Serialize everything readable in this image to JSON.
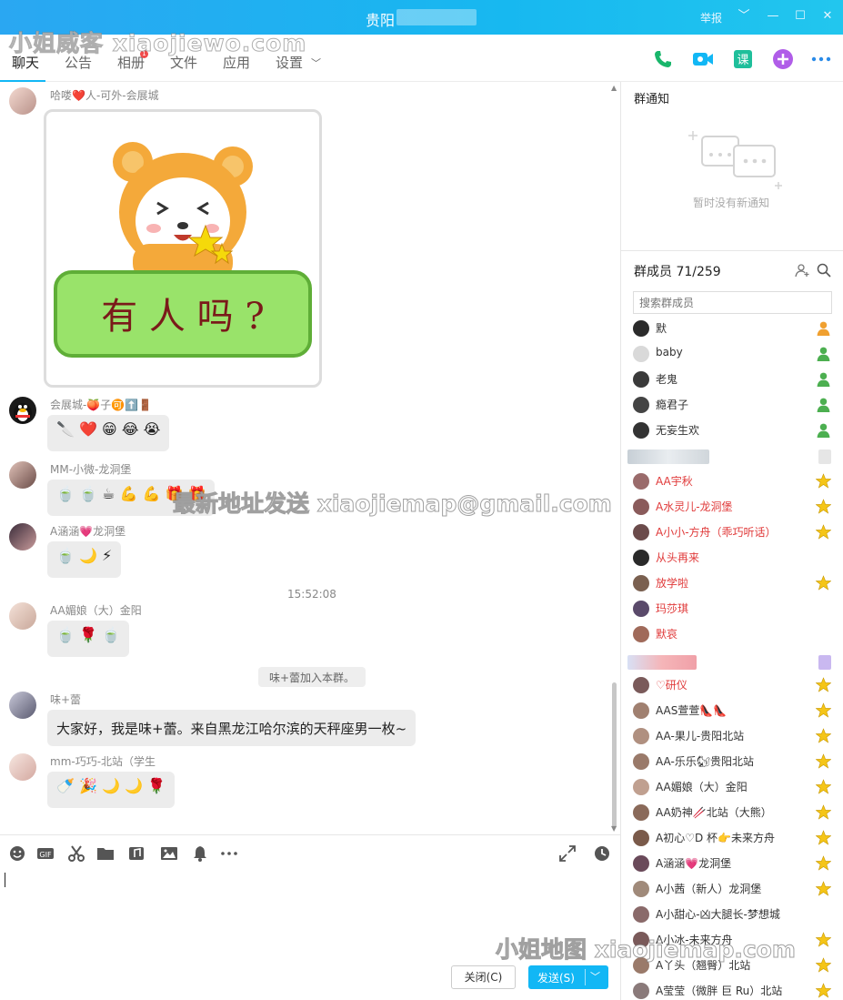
{
  "window": {
    "title": "贵阳",
    "report": "举报",
    "controls": [
      "chevron-down",
      "minimize",
      "maximize",
      "close"
    ]
  },
  "watermarks": {
    "top": "小姐威客 xiaojiewo.com",
    "middle": "最新地址发送 xiaojiemap@gmail.com",
    "bottom": "小姐地图 xiaojiemap.com"
  },
  "tabs": [
    {
      "label": "聊天",
      "active": true
    },
    {
      "label": "公告"
    },
    {
      "label": "相册",
      "badge": "1"
    },
    {
      "label": "文件"
    },
    {
      "label": "应用"
    },
    {
      "label": "设置"
    }
  ],
  "toolbar_icons": [
    "phone-icon",
    "video-icon",
    "course-icon",
    "add-app-icon",
    "more-icon"
  ],
  "messages": [
    {
      "sender": "哈喽❤️人-可外-会展城",
      "type": "sticker",
      "sticker_text": "有 人 吗 ?"
    },
    {
      "sender": "会展城-🍑子🉑⬆️🚪",
      "emojis": [
        "🔪",
        "❤️",
        "😁",
        "😂",
        "😭"
      ]
    },
    {
      "sender": "MM-小微-龙洞堡",
      "emojis": [
        "🍵",
        "🍵",
        "☕",
        "💪",
        "💪",
        "🎁",
        "🎁"
      ]
    },
    {
      "sender": "A涵涵💗龙洞堡",
      "emojis": [
        "🍵",
        "🌙",
        "⚡"
      ]
    },
    {
      "sender": "AA媚娘（大）金阳",
      "emojis": [
        "🍵",
        "🌹",
        "🍵"
      ]
    },
    {
      "sender": "味+蕾",
      "text": "大家好，我是味+蕾。来自黑龙江哈尔滨的天秤座男一枚~"
    },
    {
      "sender": "mm-巧巧-北站（学生",
      "emojis": [
        "🍼",
        "🎉",
        "🌙",
        "🌙",
        "🌹"
      ]
    }
  ],
  "timestamp": "15:52:08",
  "system_message": "味+蕾加入本群。",
  "input_toolbar": [
    "emoji-icon",
    "gif-icon",
    "scissors-icon",
    "folder-icon",
    "music-icon",
    "image-icon",
    "bell-icon",
    "more-icon"
  ],
  "buttons": {
    "close": "关闭(C)",
    "send": "发送(S)"
  },
  "notice": {
    "title": "群通知",
    "empty": "暂时没有新通知"
  },
  "members": {
    "title": "群成员 71/259",
    "search_placeholder": "搜索群成员",
    "list": [
      {
        "name": "默",
        "badge": "owner"
      },
      {
        "name": "baby",
        "badge": "admin"
      },
      {
        "name": "老鬼",
        "badge": "admin"
      },
      {
        "name": "瘾君子",
        "badge": "admin"
      },
      {
        "name": "无妄生欢",
        "badge": "admin"
      },
      {
        "name": "AA宇秋",
        "red": true,
        "badge": "star"
      },
      {
        "name": "A水灵儿-龙洞堡",
        "red": true,
        "badge": "star"
      },
      {
        "name": "A小小-方舟（乖巧听话）",
        "red": true,
        "badge": "star"
      },
      {
        "name": "从头再来",
        "red": true
      },
      {
        "name": "放学啦",
        "red": true,
        "badge": "star"
      },
      {
        "name": "玛莎琪",
        "red": true
      },
      {
        "name": "默哀",
        "red": true
      },
      {
        "name": "♡研仪",
        "red": true,
        "badge": "star"
      },
      {
        "name": "AAS萱萱👠👠",
        "badge": "star"
      },
      {
        "name": "AA-果儿-贵阳北站",
        "badge": "star"
      },
      {
        "name": "AA-乐乐🐿贵阳北站",
        "badge": "star"
      },
      {
        "name": "AA媚娘（大）金阳",
        "badge": "star"
      },
      {
        "name": "AA奶神🥢北站（大熊）",
        "badge": "star"
      },
      {
        "name": "A初心♡D 杯👉未来方舟",
        "badge": "star"
      },
      {
        "name": "A涵涵💗龙洞堡",
        "badge": "star"
      },
      {
        "name": "A小茜（新人）龙洞堡",
        "badge": "star"
      },
      {
        "name": "A小甜心-凶大腿长-梦想城"
      },
      {
        "name": "A小冰-未来方舟",
        "badge": "star"
      },
      {
        "name": "A丫头（翘臀）北站",
        "badge": "star"
      },
      {
        "name": "A莹莹（微胖 巨 Ru）北站",
        "badge": "star"
      }
    ]
  },
  "colors": {
    "title_bar": "#17b8f0",
    "send_button": "#12b7f5",
    "red_name": "#e03a3a",
    "star": "#f5c518",
    "admin_icon": "#4caf50",
    "bubble": "#ececec"
  }
}
